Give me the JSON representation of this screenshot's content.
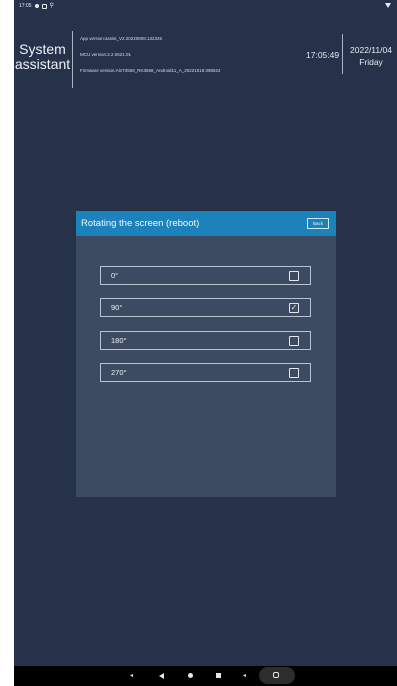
{
  "status_bar": {
    "time": "17:05"
  },
  "header": {
    "app_title": "System assistant",
    "app_version": "App version:assist_V2.20220808.132345",
    "mcu_version": "MCU version:2.2.0621.01",
    "firmware_version": "Firmware version:AlsT3568_RK3568_Android11_A_20221018.095524",
    "clock": "17:05:49",
    "date": "2022/11/04",
    "weekday": "Friday"
  },
  "dialog": {
    "title": "Rotating the screen (reboot)",
    "back_label": "Back",
    "options": [
      {
        "label": "0°",
        "checked": false
      },
      {
        "label": "90°",
        "checked": true
      },
      {
        "label": "180°",
        "checked": false
      },
      {
        "label": "270°",
        "checked": false
      }
    ]
  },
  "colors": {
    "background": "#25324a",
    "dialog_body": "#3c4b62",
    "dialog_header": "#1c82bc"
  },
  "icons": [
    "notification-dot-icon",
    "settings-icon",
    "location-icon",
    "wifi-icon",
    "volume-down-icon",
    "back-icon",
    "home-icon",
    "recents-icon",
    "volume-up-icon",
    "screenshot-icon"
  ]
}
